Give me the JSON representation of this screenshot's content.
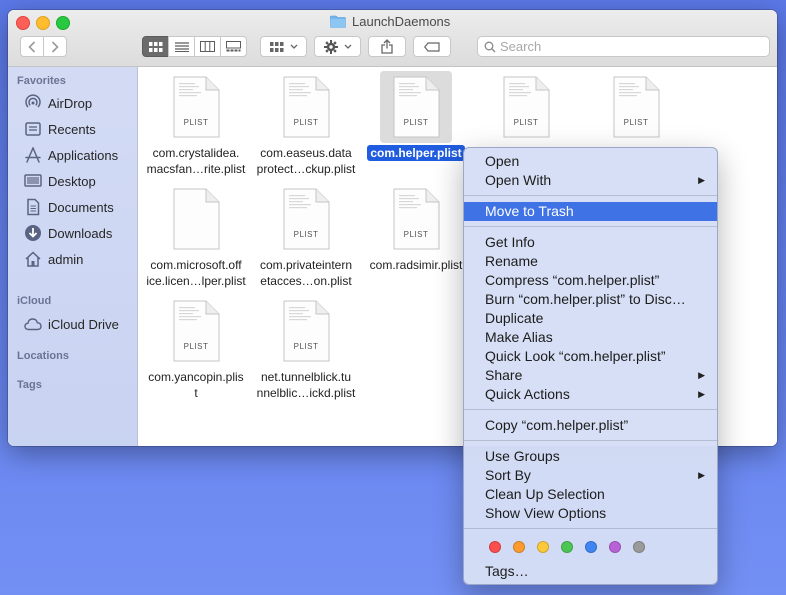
{
  "window": {
    "title": "LaunchDaemons"
  },
  "search": {
    "placeholder": "Search"
  },
  "sidebar": {
    "sections": [
      {
        "header": "Favorites",
        "items": [
          {
            "label": "AirDrop",
            "icon": "airdrop-icon"
          },
          {
            "label": "Recents",
            "icon": "recents-icon"
          },
          {
            "label": "Applications",
            "icon": "applications-icon"
          },
          {
            "label": "Desktop",
            "icon": "desktop-icon"
          },
          {
            "label": "Documents",
            "icon": "documents-icon"
          },
          {
            "label": "Downloads",
            "icon": "downloads-icon"
          },
          {
            "label": "admin",
            "icon": "home-icon"
          }
        ]
      },
      {
        "header": "iCloud",
        "items": [
          {
            "label": "iCloud Drive",
            "icon": "cloud-icon"
          }
        ]
      },
      {
        "header": "Locations",
        "items": []
      },
      {
        "header": "Tags",
        "items": []
      }
    ]
  },
  "files": [
    {
      "line1": "com.crystalidea.",
      "line2": "macsfan…rite.plist",
      "badge": "PLIST"
    },
    {
      "line1": "com.easeus.data",
      "line2": "protect…ckup.plist",
      "badge": "PLIST"
    },
    {
      "line1": "com.helper.plist",
      "line2": "",
      "badge": "PLIST",
      "selected": true
    },
    {
      "line1": "",
      "line2": "",
      "badge": "PLIST"
    },
    {
      "line1": "",
      "line2": "",
      "badge": "PLIST"
    },
    {
      "line1": "com.microsoft.off",
      "line2": "ice.licen…lper.plist",
      "badge": ""
    },
    {
      "line1": "com.privateintern",
      "line2": "etacces…on.plist",
      "badge": "PLIST"
    },
    {
      "line1": "com.radsimir.plist",
      "line2": "",
      "badge": "PLIST"
    },
    {
      "line1": "com.yancopin.plis",
      "line2": "t",
      "badge": "PLIST"
    },
    {
      "line1": "net.tunnelblick.tu",
      "line2": "nnelblic…ickd.plist",
      "badge": "PLIST"
    }
  ],
  "context_menu": {
    "items": [
      {
        "label": "Open"
      },
      {
        "label": "Open With",
        "submenu": true
      },
      {
        "label": "Move to Trash",
        "highlighted": true
      },
      {
        "label": "Get Info"
      },
      {
        "label": "Rename"
      },
      {
        "label": "Compress “com.helper.plist”"
      },
      {
        "label": "Burn “com.helper.plist” to Disc…"
      },
      {
        "label": "Duplicate"
      },
      {
        "label": "Make Alias"
      },
      {
        "label": "Quick Look “com.helper.plist”"
      },
      {
        "label": "Share",
        "submenu": true
      },
      {
        "label": "Quick Actions",
        "submenu": true
      },
      {
        "label": "Copy “com.helper.plist”"
      },
      {
        "label": "Use Groups"
      },
      {
        "label": "Sort By",
        "submenu": true
      },
      {
        "label": "Clean Up Selection"
      },
      {
        "label": "Show View Options"
      },
      {
        "label": "Tags…"
      }
    ],
    "tag_colors": [
      "#fc4e4e",
      "#fd9b2f",
      "#fcc93a",
      "#4cc653",
      "#3f86f2",
      "#b962d6",
      "#9a9a9a"
    ]
  }
}
